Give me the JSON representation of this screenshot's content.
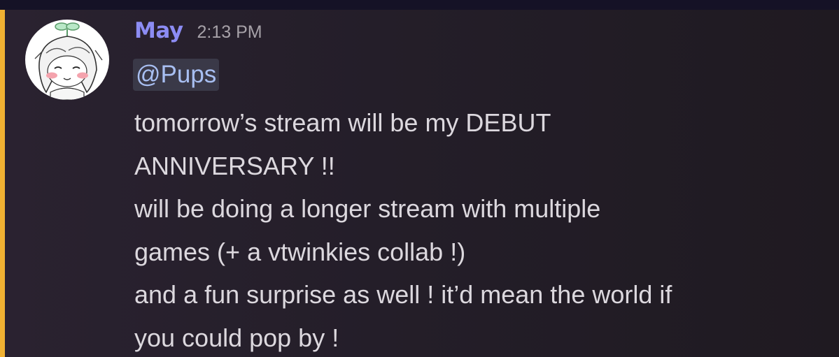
{
  "message": {
    "username": "May",
    "timestamp": "2:13 PM",
    "mention": "@Pups",
    "lines": [
      "tomorrow’s stream will be my DEBUT",
      "ANNIVERSARY !!",
      "will be doing a longer stream with multiple",
      "games (+ a vtwinkies collab !)",
      "and a fun surprise as well ! it’d mean the world if",
      "you could pop by !"
    ]
  },
  "colors": {
    "username": "#8c8cf4",
    "mention_bar": "#f0b132",
    "mention_bg": "#3a3948",
    "mention_text": "#a8bff2",
    "body_text": "#dcd8de",
    "timestamp": "#a6a1a8"
  },
  "icons": {
    "avatar": "anime-girl-avatar-with-sprout-icon"
  }
}
